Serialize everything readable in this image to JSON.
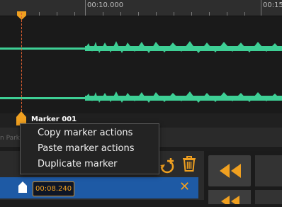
{
  "ruler": {
    "labels": [
      "00:10.000",
      "00:15"
    ]
  },
  "marker": {
    "name": "Marker 001",
    "time": "00:08.240"
  },
  "clip": {
    "name": "n Park"
  },
  "context_menu": {
    "items": [
      "Copy marker actions",
      "Paste marker actions",
      "Duplicate marker"
    ]
  },
  "marker_panel": {
    "close_label": "✕"
  },
  "colors": {
    "waveform": "#3ecf95",
    "playhead": "#f0a020",
    "accent_orange": "#f0a020",
    "selection_blue": "#1e5aa5"
  },
  "icons": [
    "playhead-icon",
    "marker-flag-icon",
    "add-marker-icon",
    "trash-icon",
    "rewind-icon",
    "close-icon"
  ]
}
